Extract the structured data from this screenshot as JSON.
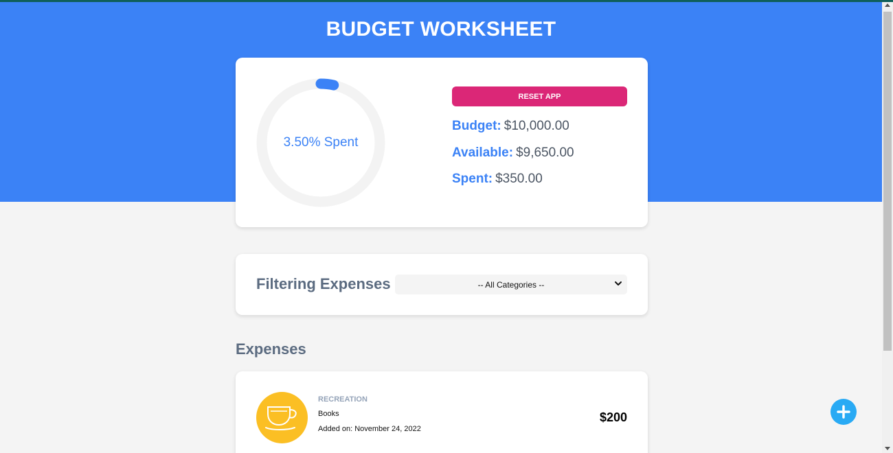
{
  "app": {
    "title": "BUDGET WORKSHEET"
  },
  "budget_card": {
    "progress_text": "3.50% Spent",
    "progress_fraction": 0.035,
    "reset_label": "RESET APP",
    "budget_label": "Budget:",
    "budget_value": "$10,000.00",
    "available_label": "Available:",
    "available_value": "$9,650.00",
    "spent_label": "Spent:",
    "spent_value": "$350.00"
  },
  "filter": {
    "label": "Filtering Expenses",
    "selected": "-- All Categories --"
  },
  "expenses": {
    "title": "Expenses",
    "items": [
      {
        "category": "RECREATION",
        "name": "Books",
        "date": "Added on: November 24, 2022",
        "amount": "$200",
        "icon": "coffee-cup-icon"
      }
    ]
  },
  "colors": {
    "header_blue": "#3b82f6",
    "reset_pink": "#db2777",
    "expense_icon_bg": "#fbbf24",
    "fab_blue": "#29aaf4",
    "page_bg": "#f4f4f4"
  }
}
